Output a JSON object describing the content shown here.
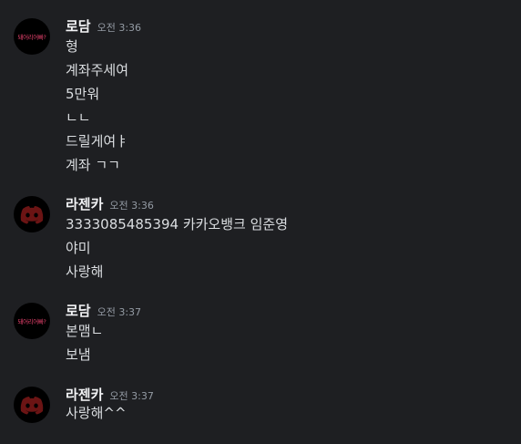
{
  "groups": [
    {
      "author": "로담",
      "timestamp": "오전 3:36",
      "avatar": {
        "type": "text-logo",
        "text": "돼어리어빠?",
        "text_color": "#e0406a",
        "bg": "#000000"
      },
      "messages": [
        "형",
        "계좌주세여",
        "5만워",
        "ㄴㄴ",
        "드릴게여ㅑ",
        "계좌 ㄱㄱ"
      ]
    },
    {
      "author": "라젠카",
      "timestamp": "오전 3:36",
      "avatar": {
        "type": "discord-logo",
        "icon": "discord-logo-icon",
        "color": "#6b1414",
        "bg": "#000000"
      },
      "messages": [
        "3333085485394 카카오뱅크 임준영",
        "야미",
        "사랑해"
      ]
    },
    {
      "author": "로담",
      "timestamp": "오전 3:37",
      "avatar": {
        "type": "text-logo",
        "text": "돼어리어빠?",
        "text_color": "#e0406a",
        "bg": "#000000"
      },
      "messages": [
        "본맴ㄴ",
        "보냄"
      ]
    },
    {
      "author": "라젠카",
      "timestamp": "오전 3:37",
      "avatar": {
        "type": "discord-logo",
        "icon": "discord-logo-icon",
        "color": "#6b1414",
        "bg": "#000000"
      },
      "messages": [
        "사랑해^^"
      ]
    }
  ],
  "colors": {
    "background": "#1e1f22",
    "username": "#f2f3f5",
    "timestamp": "#949ba4",
    "message_text": "#dbdee1"
  }
}
